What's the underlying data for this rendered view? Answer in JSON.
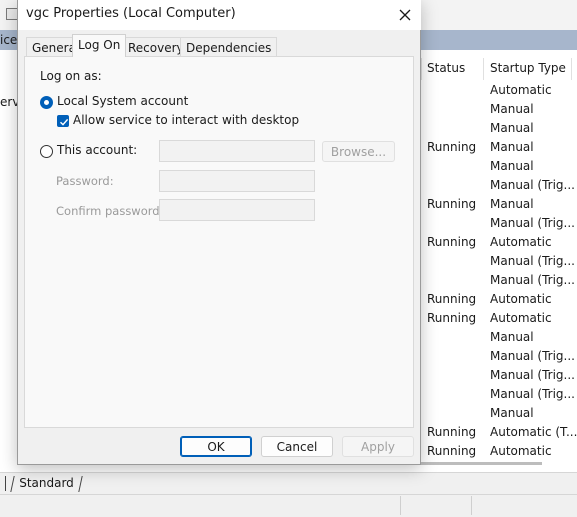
{
  "background": {
    "selected_fragment": "ice",
    "left_fragment": "erv",
    "columns": {
      "status": "Status",
      "startup_type": "Startup Type"
    },
    "rows": [
      {
        "status": "",
        "startup": "Automatic"
      },
      {
        "status": "",
        "startup": "Manual"
      },
      {
        "status": "",
        "startup": "Manual"
      },
      {
        "status": "Running",
        "startup": "Manual"
      },
      {
        "status": "",
        "startup": "Manual"
      },
      {
        "status": "",
        "startup": "Manual (Trig..."
      },
      {
        "status": "Running",
        "startup": "Manual"
      },
      {
        "status": "",
        "startup": "Manual (Trig..."
      },
      {
        "status": "Running",
        "startup": "Automatic"
      },
      {
        "status": "",
        "startup": "Manual (Trig..."
      },
      {
        "status": "",
        "startup": "Manual (Trig..."
      },
      {
        "status": "Running",
        "startup": "Automatic"
      },
      {
        "status": "Running",
        "startup": "Automatic"
      },
      {
        "status": "",
        "startup": "Manual"
      },
      {
        "status": "",
        "startup": "Manual (Trig..."
      },
      {
        "status": "",
        "startup": "Manual (Trig..."
      },
      {
        "status": "",
        "startup": "Manual (Trig..."
      },
      {
        "status": "",
        "startup": "Manual"
      },
      {
        "status": "Running",
        "startup": "Automatic (T..."
      },
      {
        "status": "Running",
        "startup": "Automatic"
      }
    ],
    "bottom_tab": "Standard"
  },
  "dialog": {
    "title": "vgc Properties (Local Computer)",
    "tabs": [
      "General",
      "Log On",
      "Recovery",
      "Dependencies"
    ],
    "active_tab": "Log On",
    "logon": {
      "log_on_as": "Log on as:",
      "local_system": "Local System account",
      "local_system_selected": true,
      "allow_interact": "Allow service to interact with desktop",
      "allow_interact_checked": true,
      "this_account": "This account:",
      "account_value": "",
      "browse": "Browse...",
      "password": "Password:",
      "password_value": "",
      "confirm_password": "Confirm password:",
      "confirm_value": ""
    },
    "buttons": {
      "ok": "OK",
      "cancel": "Cancel",
      "apply": "Apply"
    }
  },
  "colors": {
    "accent": "#005fb8",
    "selection_strip": "#a7b6cc"
  },
  "icons": {
    "close": "close-icon",
    "checkmark": "checkmark-icon"
  }
}
